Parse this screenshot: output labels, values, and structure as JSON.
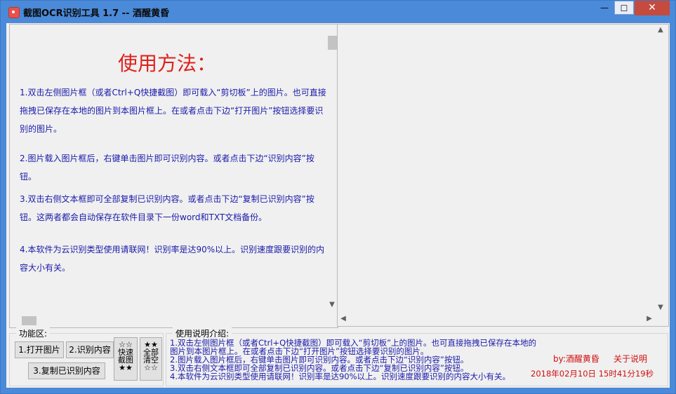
{
  "window": {
    "title": "截图OCR识别工具 1.7 -- 酒醒黄昏",
    "controls": {
      "minimize": "—",
      "maximize": "☐",
      "close": "✕"
    }
  },
  "guide": {
    "title": "使用方法：",
    "steps": [
      "1.双击左侧图片框（或者Ctrl+Q快捷截图）即可载入“剪切板”上的图片。也可直接拖拽已保存在本地的图片到本图片框上。在或者点击下边“打开图片”按钮选择要识别的图片。",
      "2.图片载入图片框后，右键单击图片即可识别内容。或者点击下边“识别内容”按钮。",
      "3.双击右侧文本框即可全部复制已识别内容。或者点击下边“复制已识别内容”按钮。这两者都会自动保存在软件目录下一份word和TXT文档备份。",
      "4.本软件为云识别类型使用请联网！识别率是达90%以上。识别速度跟要识别的内容大小有关。"
    ]
  },
  "functions": {
    "legend": "功能区:",
    "open_image": "1.打开图片",
    "recognize": "2.识别内容",
    "copy_result": "3.复制已识别内容",
    "screenshot_btn": "☆☆\n快速\n截图\n★★",
    "clear_btn": "★★\n全部\n清空\n☆☆"
  },
  "info": {
    "legend": "使用说明介绍:",
    "lines": [
      "1.双击左侧图片框（或者Ctrl+Q快捷截图）即可载入“剪切板”上的图片。也可直接拖拽已保存在本地的图片到本图片框上。在或者点击下边“打开图片”按钮选择要识别的图片。",
      "2.图片载入图片框后，右键单击图片即可识别内容。或者点击下边“识别内容”按钮。",
      "3.双击右侧文本框即可全部复制已识别内容。或者点击下边“复制已识别内容”按钮。",
      "4.本软件为云识别类型使用请联网！识别率是达90%以上。识别速度跟要识别的内容大小有关。"
    ],
    "author": "by:酒醒黄昏",
    "about": "关于说明",
    "datetime": "2018年02月10日  15时41分19秒"
  },
  "colors": {
    "titlebar": "#4a8ad8",
    "guide_title": "#e0201a",
    "guide_text": "#1a1aaa",
    "accent_red": "#d01010"
  }
}
